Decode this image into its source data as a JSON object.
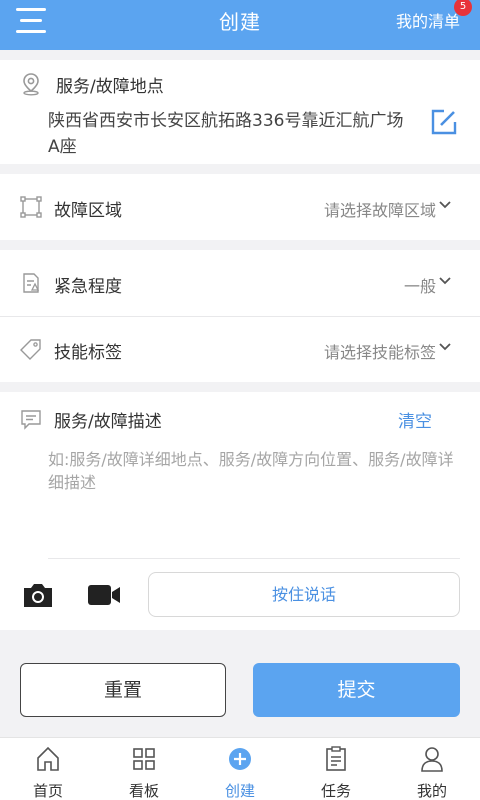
{
  "header": {
    "title": "创建",
    "my_list": "我的清单",
    "badge": "5"
  },
  "address": {
    "label": "服务/故障地点",
    "value": "陕西省西安市长安区航拓路336号靠近汇航广场A座"
  },
  "fault_area": {
    "label": "故障区域",
    "placeholder": "请选择故障区域"
  },
  "urgency": {
    "label": "紧急程度",
    "value": "一般"
  },
  "skill": {
    "label": "技能标签",
    "placeholder": "请选择技能标签"
  },
  "description": {
    "label": "服务/故障描述",
    "clear": "清空",
    "placeholder": "如:服务/故障详细地点、服务/故障方向位置、服务/故障详细描述"
  },
  "voice": {
    "label": "按住说话"
  },
  "actions": {
    "reset": "重置",
    "submit": "提交"
  },
  "tabs": [
    {
      "label": "首页",
      "icon": "home-icon"
    },
    {
      "label": "看板",
      "icon": "grid-icon"
    },
    {
      "label": "创建",
      "icon": "plus-circle-icon",
      "active": true
    },
    {
      "label": "任务",
      "icon": "task-icon"
    },
    {
      "label": "我的",
      "icon": "user-icon"
    }
  ],
  "colors": {
    "primary": "#5ba4f0",
    "link": "#4a90e2",
    "badge": "#e8333a"
  }
}
